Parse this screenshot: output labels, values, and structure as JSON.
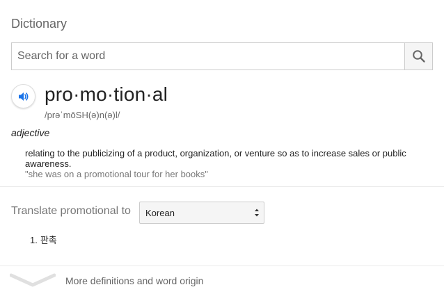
{
  "card": {
    "title": "Dictionary",
    "search": {
      "placeholder": "Search for a word",
      "value": ""
    },
    "entry": {
      "headword": "pro·mo·tion·al",
      "phonetic": "/prəˈmōSH(ə)n(ə)l/",
      "part_of_speech": "adjective",
      "definition": "relating to the publicizing of a product, organization, or venture so as to increase sales or public awareness.",
      "example": "\"she was on a promotional tour for her books\""
    },
    "translate": {
      "label": "Translate promotional to",
      "selected_language": "Korean",
      "results": [
        {
          "number": "1.",
          "text": "판촉"
        }
      ]
    },
    "more_link": "More definitions and word origin",
    "icons": {
      "search": "search-icon",
      "speaker": "speaker-icon",
      "select": "select-arrows-icon",
      "expand": "chevron-down-icon"
    },
    "colors": {
      "accent": "#1a73e8",
      "muted_text": "#777777",
      "border": "#cccccc"
    }
  }
}
